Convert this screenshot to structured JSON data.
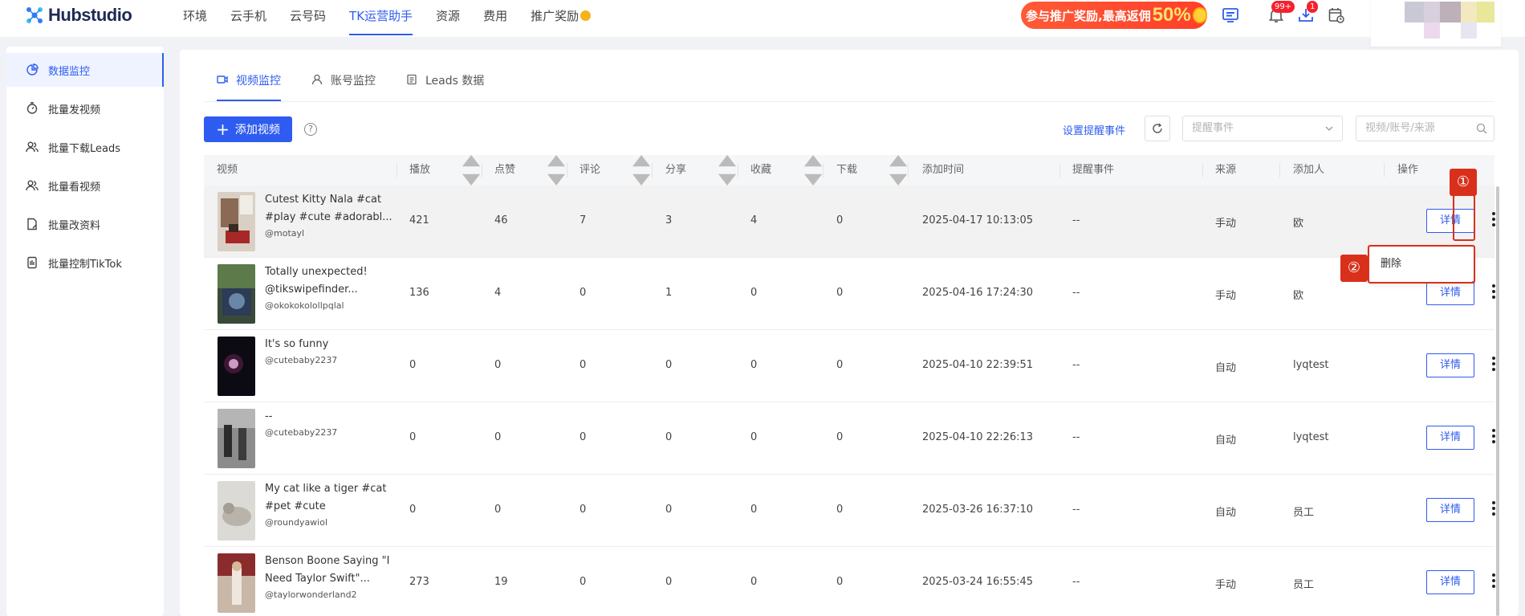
{
  "app": {
    "logo": "Hubstudio",
    "nav": [
      "环境",
      "云手机",
      "云号码",
      "TK运营助手",
      "资源",
      "费用",
      "推广奖励"
    ],
    "nav_active": 3,
    "promo_text": "参与推广奖励,最高返佣",
    "promo_pct": "50%",
    "notif_badge": "99+",
    "download_badge": "1"
  },
  "sidebar": {
    "items": [
      {
        "label": "数据监控",
        "icon": "chart-pie-icon"
      },
      {
        "label": "批量发视频",
        "icon": "send-icon"
      },
      {
        "label": "批量下载Leads",
        "icon": "users-icon"
      },
      {
        "label": "批量看视频",
        "icon": "users-icon"
      },
      {
        "label": "批量改资料",
        "icon": "document-edit-icon"
      },
      {
        "label": "批量控制TikTok",
        "icon": "phone-icon"
      }
    ],
    "active": 0
  },
  "tabs": [
    "视频监控",
    "账号监控",
    "Leads 数据"
  ],
  "toolbar": {
    "add_label": "添加视频",
    "set_reminder_label": "设置提醒事件",
    "reminder_placeholder": "提醒事件",
    "search_placeholder": "视频/账号/来源"
  },
  "table": {
    "headers": [
      "视频",
      "播放",
      "点赞",
      "评论",
      "分享",
      "收藏",
      "下载",
      "添加时间",
      "提醒事件",
      "来源",
      "添加人",
      "操作"
    ],
    "detail_label": "详情",
    "rows": [
      {
        "title1": "Cutest Kitty Nala #cat",
        "title2": "#play #cute #adorabl...",
        "user": "@motayl",
        "play": "421",
        "like": "46",
        "comment": "7",
        "share": "3",
        "fav": "4",
        "download": "0",
        "time": "2025-04-17 10:13:05",
        "remind": "--",
        "source": "手动",
        "adder": "欧"
      },
      {
        "title1": "Totally unexpected!",
        "title2": "@tikswipefinder...",
        "user": "@okokokolollpqlal",
        "play": "136",
        "like": "4",
        "comment": "0",
        "share": "1",
        "fav": "0",
        "download": "0",
        "time": "2025-04-16 17:24:30",
        "remind": "--",
        "source": "手动",
        "adder": "欧"
      },
      {
        "title1": "It's so funny",
        "title2": "",
        "user": "@cutebaby2237",
        "play": "0",
        "like": "0",
        "comment": "0",
        "share": "0",
        "fav": "0",
        "download": "0",
        "time": "2025-04-10 22:39:51",
        "remind": "--",
        "source": "自动",
        "adder": "lyqtest"
      },
      {
        "title1": "--",
        "title2": "",
        "user": "@cutebaby2237",
        "play": "0",
        "like": "0",
        "comment": "0",
        "share": "0",
        "fav": "0",
        "download": "0",
        "time": "2025-04-10 22:26:13",
        "remind": "--",
        "source": "自动",
        "adder": "lyqtest"
      },
      {
        "title1": "My cat like a tiger #cat",
        "title2": "#pet #cute",
        "user": "@roundyawiol",
        "play": "0",
        "like": "0",
        "comment": "0",
        "share": "0",
        "fav": "0",
        "download": "0",
        "time": "2025-03-26 16:37:10",
        "remind": "--",
        "source": "自动",
        "adder": "员工"
      },
      {
        "title1": "Benson Boone Saying \"I",
        "title2": "Need Taylor Swift\"...",
        "user": "@taylorwonderland2",
        "play": "273",
        "like": "19",
        "comment": "0",
        "share": "0",
        "fav": "0",
        "download": "0",
        "time": "2025-03-24 16:55:45",
        "remind": "--",
        "source": "手动",
        "adder": "员工"
      }
    ]
  },
  "dropdown": {
    "delete_label": "删除"
  },
  "annotations": {
    "step1": "①",
    "step2": "②"
  },
  "colors": {
    "accent": "#2f5cf0",
    "annotation": "#d9301c",
    "promo": "#ff4a30"
  }
}
